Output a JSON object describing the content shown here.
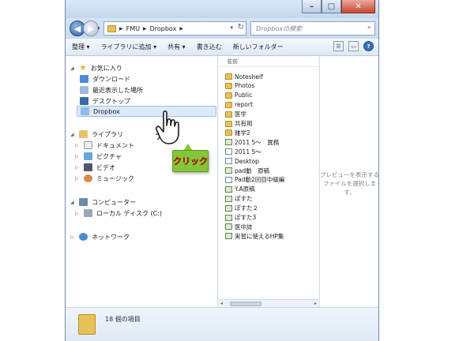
{
  "window": {
    "caption_buttons": [
      "–",
      "□",
      "✕"
    ]
  },
  "address": {
    "crumbs": [
      "FMU",
      "Dropbox"
    ],
    "search_placeholder": "Dropboxの検索"
  },
  "toolbar": {
    "organize": "整理 ▾",
    "add_to_library": "ライブラリに追加 ▾",
    "share": "共有 ▾",
    "burn": "書き込む",
    "new_folder": "新しいフォルダー"
  },
  "nav": {
    "favorites": "お気に入り",
    "downloads": "ダウンロード",
    "recent": "最近表示した場所",
    "desktop": "デスクトップ",
    "dropbox": "Dropbox",
    "libraries": "ライブラリ",
    "documents": "ドキュメント",
    "pictures": "ピクチャ",
    "videos": "ビデオ",
    "music": "ミュージック",
    "computer": "コンピューター",
    "local_disk": "ローカル ディスク (C:)",
    "network": "ネットワーク"
  },
  "list": {
    "column_name": "名前",
    "items": [
      {
        "name": "Noteshelf",
        "kind": "folder"
      },
      {
        "name": "Photos",
        "kind": "folder"
      },
      {
        "name": "Public",
        "kind": "folder"
      },
      {
        "name": "report",
        "kind": "folder"
      },
      {
        "name": "医学",
        "kind": "folder"
      },
      {
        "name": "共有用",
        "kind": "folder"
      },
      {
        "name": "雑学2",
        "kind": "folder"
      },
      {
        "name": "2011 5～　異務",
        "kind": "docc"
      },
      {
        "name": "2011 5～",
        "kind": "doc"
      },
      {
        "name": "Desktop",
        "kind": "doc"
      },
      {
        "name": "pad動　原稿",
        "kind": "docc"
      },
      {
        "name": "Pad動2回目中級編",
        "kind": "doc"
      },
      {
        "name": "Y.A原稿",
        "kind": "docc"
      },
      {
        "name": "ぽすた",
        "kind": "docc"
      },
      {
        "name": "ぽすた２",
        "kind": "docc"
      },
      {
        "name": "ぽすた3",
        "kind": "docc"
      },
      {
        "name": "医中誌",
        "kind": "docc"
      },
      {
        "name": "実習に使えるHP集",
        "kind": "docc"
      }
    ]
  },
  "preview": {
    "line1": "プレビューを表示する",
    "line2": "ファイルを選択しま",
    "line3": "す。"
  },
  "status": {
    "count_text": "18 個の項目"
  },
  "annotation": {
    "callout_text": "クリック"
  }
}
